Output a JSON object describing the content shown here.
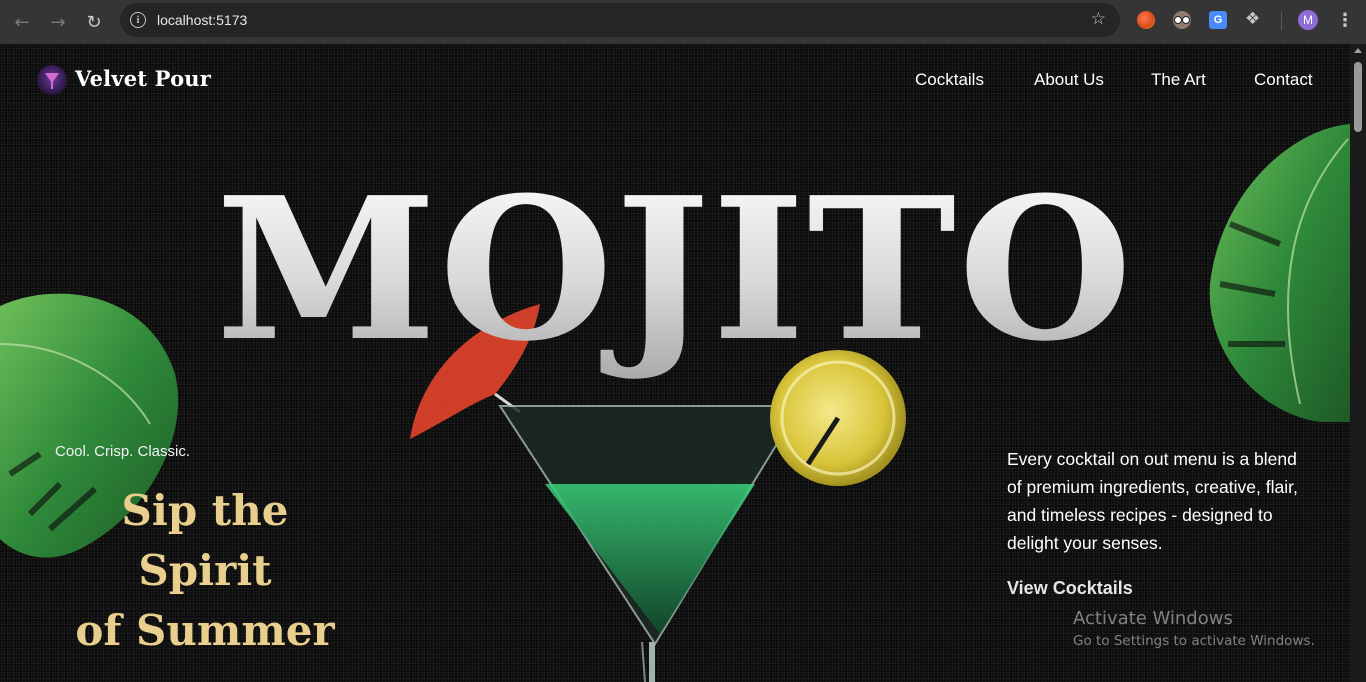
{
  "browser": {
    "url": "localhost:5173",
    "profile_initial": "M",
    "icons": [
      "back-icon",
      "forward-icon",
      "reload-icon",
      "info-icon",
      "star-icon",
      "extensions-puzzle-icon",
      "menu-kebab-icon"
    ]
  },
  "site": {
    "brand": "Velvet Pour",
    "nav": [
      {
        "label": "Cocktails"
      },
      {
        "label": "About Us"
      },
      {
        "label": "The Art"
      },
      {
        "label": "Contact"
      }
    ]
  },
  "hero": {
    "title": "MOJITO",
    "tagline_small": "Cool. Crisp. Classic.",
    "tagline_big_line1": "Sip the Spirit",
    "tagline_big_line2": "of Summer",
    "description": "Every cocktail on out menu is a blend of premium ingredients, creative, flair, and timeless recipes - designed to delight your senses.",
    "cta": "View Cocktails"
  },
  "overlay": {
    "watermark_title": "Activate Windows",
    "watermark_sub": "Go to Settings to activate Windows."
  },
  "colors": {
    "background": "#0b0b0b",
    "accent_gold": "#e8cf8e",
    "chrome_bar": "#353535"
  }
}
